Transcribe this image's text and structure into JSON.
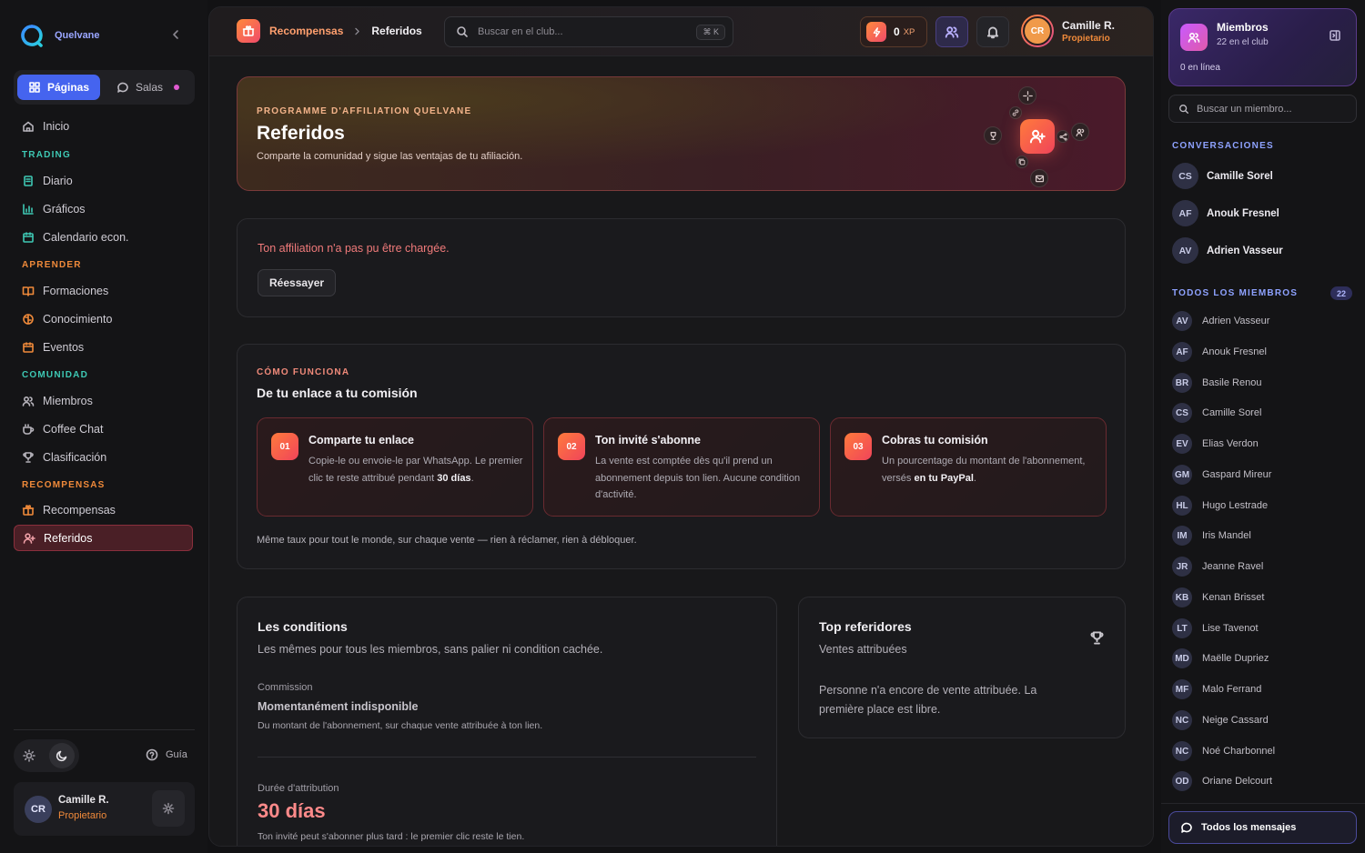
{
  "sidebar": {
    "brand": "Quelvane",
    "tab_pages": "Páginas",
    "tab_rooms": "Salas",
    "home": "Inicio",
    "sections": [
      {
        "title": "TRADING",
        "items": [
          "Diario",
          "Gráficos",
          "Calendario econ."
        ]
      },
      {
        "title": "APRENDER",
        "items": [
          "Formaciones",
          "Conocimiento",
          "Eventos"
        ]
      },
      {
        "title": "COMUNIDAD",
        "items": [
          "Miembros",
          "Coffee Chat",
          "Clasificación"
        ]
      },
      {
        "title": "RECOMPENSAS",
        "items": [
          "Recompensas",
          "Referidos"
        ]
      }
    ],
    "guide": "Guía",
    "user_initials": "CR",
    "user_name": "Camille R.",
    "user_role": "Propietario"
  },
  "topbar": {
    "crumb_parent": "Recompensas",
    "crumb_current": "Referidos",
    "search_placeholder": "Buscar en el club...",
    "shortcut": "⌘ K",
    "xp_value": "0",
    "xp_label": "XP",
    "user_initials": "CR",
    "user_name": "Camille R.",
    "user_role": "Propietario"
  },
  "hero": {
    "eyebrow": "PROGRAMME D'AFFILIATION QUELVANE",
    "title": "Referidos",
    "subtitle": "Comparte la comunidad y sigue las ventajas de tu afiliación."
  },
  "error": {
    "message": "Ton affiliation n'a pas pu être chargée.",
    "retry": "Réessayer"
  },
  "how": {
    "eyebrow": "CÓMO FUNCIONA",
    "title": "De tu enlace a tu comisión",
    "steps": [
      {
        "num": "01",
        "title": "Comparte tu enlace",
        "body_a": "Copie-le ou envoie-le par WhatsApp. Le premier clic te reste attribué pendant ",
        "body_b": "30 días",
        "body_c": "."
      },
      {
        "num": "02",
        "title": "Ton invité s'abonne",
        "body_a": "La vente est comptée dès qu'il prend un abonnement depuis ton lien. Aucune condition d'activité.",
        "body_b": "",
        "body_c": ""
      },
      {
        "num": "03",
        "title": "Cobras tu comisión",
        "body_a": "Un pourcentage du montant de l'abonnement, versés ",
        "body_b": "en tu PayPal",
        "body_c": "."
      }
    ],
    "footnote": "Même taux pour tout le monde, sur chaque vente — rien à réclamer, rien à débloquer."
  },
  "conditions": {
    "title": "Les conditions",
    "subtitle": "Les mêmes pour tous les miembros, sans palier ni condition cachée.",
    "commission_label": "Commission",
    "commission_value": "Momentanément indisponible",
    "commission_desc": "Du montant de l'abonnement, sur chaque vente attribuée à ton lien.",
    "duration_label": "Durée d'attribution",
    "duration_value": "30 días",
    "duration_desc": "Ton invité peut s'abonner plus tard : le premier clic reste le tien."
  },
  "top": {
    "title": "Top referidores",
    "subtitle": "Ventes attribuées",
    "empty": "Personne n'a encore de vente attribuée. La première place est libre."
  },
  "right": {
    "members_title": "Miembros",
    "members_sub": "22 en el club",
    "online": "0 en línea",
    "search_placeholder": "Buscar un miembro...",
    "conv_title": "CONVERSACIONES",
    "conversations": [
      {
        "initials": "CS",
        "name": "Camille Sorel"
      },
      {
        "initials": "AF",
        "name": "Anouk Fresnel"
      },
      {
        "initials": "AV",
        "name": "Adrien Vasseur"
      }
    ],
    "all_title": "TODOS LOS MIEMBROS",
    "all_count": "22",
    "members": [
      {
        "initials": "AV",
        "name": "Adrien Vasseur"
      },
      {
        "initials": "AF",
        "name": "Anouk Fresnel"
      },
      {
        "initials": "BR",
        "name": "Basile Renou"
      },
      {
        "initials": "CS",
        "name": "Camille Sorel"
      },
      {
        "initials": "EV",
        "name": "Elias Verdon"
      },
      {
        "initials": "GM",
        "name": "Gaspard Mireur"
      },
      {
        "initials": "HL",
        "name": "Hugo Lestrade"
      },
      {
        "initials": "IM",
        "name": "Iris Mandel"
      },
      {
        "initials": "JR",
        "name": "Jeanne Ravel"
      },
      {
        "initials": "KB",
        "name": "Kenan Brisset"
      },
      {
        "initials": "LT",
        "name": "Lise Tavenot"
      },
      {
        "initials": "MD",
        "name": "Maëlle Dupriez"
      },
      {
        "initials": "MF",
        "name": "Malo Ferrand"
      },
      {
        "initials": "NC",
        "name": "Neige Cassard"
      },
      {
        "initials": "NC",
        "name": "Noé Charbonnel"
      },
      {
        "initials": "OD",
        "name": "Oriane Delcourt"
      }
    ],
    "all_messages": "Todos los mensajes"
  },
  "colors": {
    "accent": "#4564ef",
    "brand_orange": "#f08a3a",
    "error": "#f07a7a",
    "active_bg": "#4a1f26"
  }
}
